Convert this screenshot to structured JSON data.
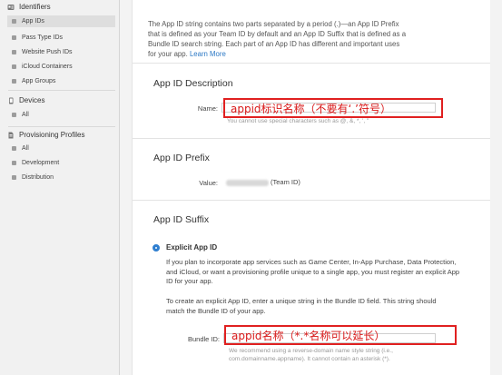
{
  "sidebar": {
    "sections": [
      {
        "title": "Identifiers",
        "icon": "id-card-icon",
        "items": [
          "App IDs",
          "Pass Type IDs",
          "Website Push IDs",
          "iCloud Containers",
          "App Groups"
        ]
      },
      {
        "title": "Devices",
        "icon": "device-icon",
        "items": [
          "All"
        ]
      },
      {
        "title": "Provisioning Profiles",
        "icon": "profile-document-icon",
        "items": [
          "All",
          "Development",
          "Distribution"
        ]
      }
    ],
    "active_item": "App IDs"
  },
  "intro": {
    "text": "The App ID string contains two parts separated by a period (.)—an App ID Prefix that is defined as your Team ID by default and an App ID Suffix that is defined as a Bundle ID search string. Each part of an App ID has different and important uses for your app.",
    "link": "Learn More"
  },
  "description": {
    "title": "App ID Description",
    "name_label": "Name:",
    "name_value": "",
    "hint": "You cannot use special characters such as @, &, *, ', \"",
    "annotation": "appid标识名称（不要有‘.’符号）"
  },
  "prefix": {
    "title": "App ID Prefix",
    "value_label": "Value:",
    "value_suffix": "(Team ID)"
  },
  "suffix": {
    "title": "App ID Suffix",
    "option_label": "Explicit App ID",
    "option_text": "If you plan to incorporate app services such as Game Center, In-App Purchase, Data Protection, and iCloud, or want a provisioning profile unique to a single app, you must register an explicit App ID for your app.",
    "instruction": "To create an explicit App ID, enter a unique string in the Bundle ID field. This string should match the Bundle ID of your app.",
    "bundle_label": "Bundle ID:",
    "bundle_value": "",
    "hint": "We recommend using a reverse-domain name style string (i.e., com.domainname.appname). It cannot contain an asterisk (*).",
    "annotation": "appid名称（*.*名称可以延长）"
  },
  "colors": {
    "accent": "#2f7fd0",
    "annotation": "#e02020",
    "link": "#2b78c5"
  }
}
